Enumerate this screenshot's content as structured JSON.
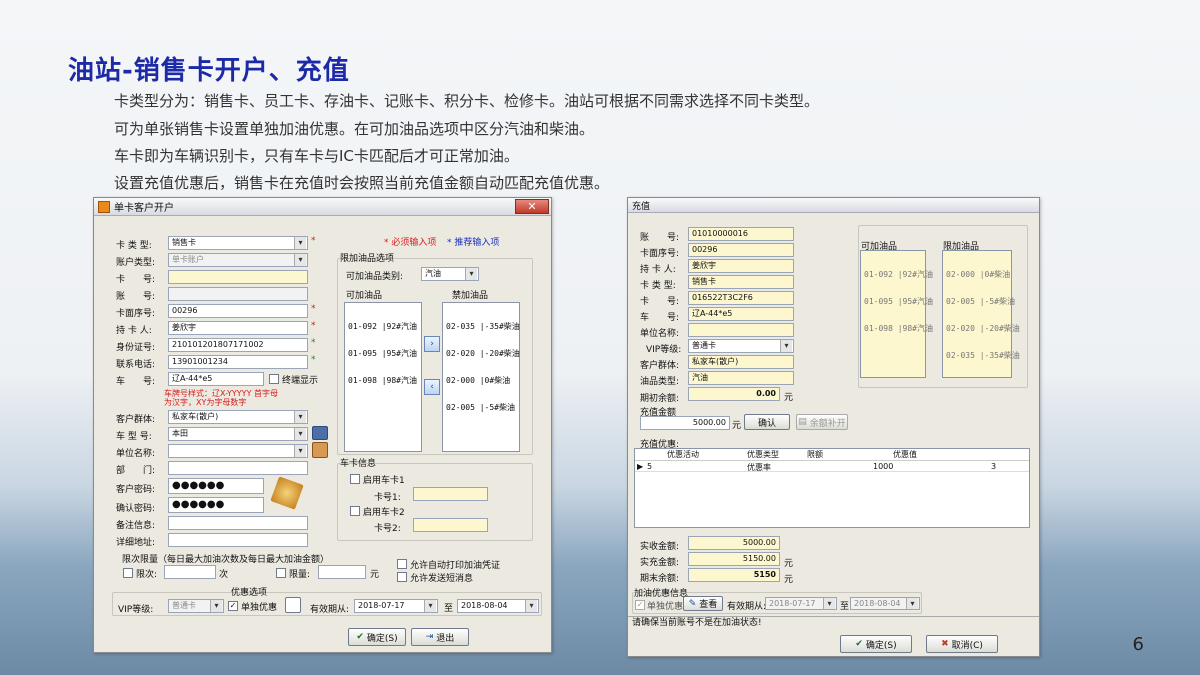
{
  "slide": {
    "title": "油站-销售卡开户、充值",
    "bullets": [
      "卡类型分为：销售卡、员工卡、存油卡、记账卡、积分卡、检修卡。油站可根据不同需求选择不同卡类型。",
      "可为单张销售卡设置单独加油优惠。在可加油品选项中区分汽油和柴油。",
      "车卡即为车辆识别卡，只有车卡与IC卡匹配后才可正常加油。",
      "设置充值优惠后，销售卡在充值时会按照当前充值金额自动匹配充值优惠。"
    ],
    "page_number": "6"
  },
  "open_account": {
    "title": "单卡客户开户",
    "close": "✕",
    "legend_required": "* 必须输入项",
    "legend_recommended": "* 推荐输入项",
    "labels": {
      "card_type": "卡 类 型:",
      "account_type": "账户类型:",
      "card_no": "卡　　号:",
      "account_no": "账　　号:",
      "face_no": "卡面序号:",
      "holder": "持 卡 人:",
      "id_no": "身份证号:",
      "phone": "联系电话:",
      "plate": "车　　号:",
      "group": "客户群体:",
      "car_model": "车 型 号:",
      "company": "单位名称:",
      "dept": "部　　门:",
      "password": "客户密码:",
      "confirm_password": "确认密码:",
      "remark": "备注信息:",
      "address": "详细地址:"
    },
    "values": {
      "card_type": "销售卡",
      "account_type": "单卡账户",
      "card_no": "",
      "account_no": "",
      "face_no": "00296",
      "holder": "姜欣宇",
      "id_no": "210101201807171002",
      "phone": "13901001234",
      "plate": "辽A-44*e5",
      "group": "私家车(散户)",
      "car_model": "本田",
      "company": "",
      "dept": "",
      "password": "●●●●●●",
      "confirm_password": "●●●●●●",
      "remark": "",
      "address": ""
    },
    "terminal_display": "终端显示",
    "plate_hint_1": "车牌号样式：辽X-YYYYY 首字母",
    "plate_hint_2": "为汉字，XY为字母数字",
    "oil_limit": {
      "title": "限加油品选项",
      "category_label": "可加油品类别:",
      "category_value": "汽油",
      "allowed_title": "可加油品",
      "banned_title": "禁加油品",
      "allowed": [
        "01-092 |92#汽油",
        "01-095 |95#汽油",
        "01-098 |98#汽油"
      ],
      "banned": [
        "02-035 |-35#柴油",
        "02-020 |-20#柴油",
        "02-000 |0#柴油",
        "02-005 |-5#柴油"
      ],
      "move_right": "›",
      "move_left": "‹"
    },
    "vehicle_card": {
      "title": "车卡信息",
      "enable1": "启用车卡1",
      "no1": "卡号1:",
      "enable2": "启用车卡2",
      "no2": "卡号2:"
    },
    "quota": {
      "title": "限次限量（每日最大加油次数及每日最大加油金额）",
      "count_label": "限次:",
      "count_unit": "次",
      "amount_label": "限量:",
      "amount_unit": "元",
      "auto_print": "允许自动打印加油凭证",
      "send_sms": "允许发送短消息"
    },
    "discount": {
      "title": "优惠选项",
      "vip_label": "VIP等级:",
      "vip_value": "普通卡",
      "single": "单独优惠",
      "valid_from_label": "有效期从:",
      "valid_from": "2018-07-17",
      "to_label": "至",
      "valid_to": "2018-08-04"
    },
    "buttons": {
      "ok": "确定(S)",
      "exit": "退出"
    }
  },
  "recharge": {
    "title": "充值",
    "labels": {
      "account": "账　　号:",
      "face_no": "卡面序号:",
      "holder": "持 卡 人:",
      "card_type": "卡 类 型:",
      "card_no": "卡　　号:",
      "plate": "车　　号:",
      "company": "单位名称:",
      "vip": "VIP等级:",
      "group": "客户群体:",
      "oil_type": "油品类型:",
      "opening": "期初余额:"
    },
    "values": {
      "account": "01010000016",
      "face_no": "00296",
      "holder": "姜欣宇",
      "card_type": "销售卡",
      "card_no": "016522T3C2F6",
      "plate": "辽A-44*e5",
      "company": "",
      "vip": "普通卡",
      "group": "私家车(散户)",
      "oil_type": "汽油",
      "opening": "0.00"
    },
    "unit": "元",
    "allowed_title": "可加油品",
    "allowed": [
      "01-092 |92#汽油",
      "01-095 |95#汽油",
      "01-098 |98#汽油"
    ],
    "limited_title": "限加油品",
    "limited": [
      "02-000 |0#柴油",
      "02-005 |-5#柴油",
      "02-020 |-20#柴油",
      "02-035 |-35#柴油"
    ],
    "amount_label": "充值金额",
    "amount_value": "5000.00",
    "confirm": "确认",
    "balance_fill": "余额补开",
    "discount_title": "充值优惠:",
    "table": {
      "headers": [
        "优惠活动",
        "优惠类型",
        "限额",
        "优惠值"
      ],
      "rows": [
        [
          "5",
          "优惠率",
          "1000",
          "3"
        ]
      ]
    },
    "paid_label": "实收金额:",
    "paid": "5000.00",
    "real_label": "实充金额:",
    "real": "5150.00",
    "end_label": "期末余额:",
    "end": "5150",
    "fuel_discount": {
      "title": "加油优惠信息",
      "single": "单独优惠",
      "view": "查看",
      "valid_from_label": "有效期从:",
      "valid_from": "2018-07-17",
      "to_label": "至",
      "valid_to": "2018-08-04"
    },
    "status": "请确保当前账号不是在加油状态!",
    "buttons": {
      "ok": "确定(S)",
      "cancel": "取消(C)"
    }
  },
  "colors": {
    "title_blue": "#1d2aa8",
    "required_red": "#d01c1c",
    "recommended_green": "#1c8a30",
    "input_yellow": "#fdf7cf"
  }
}
